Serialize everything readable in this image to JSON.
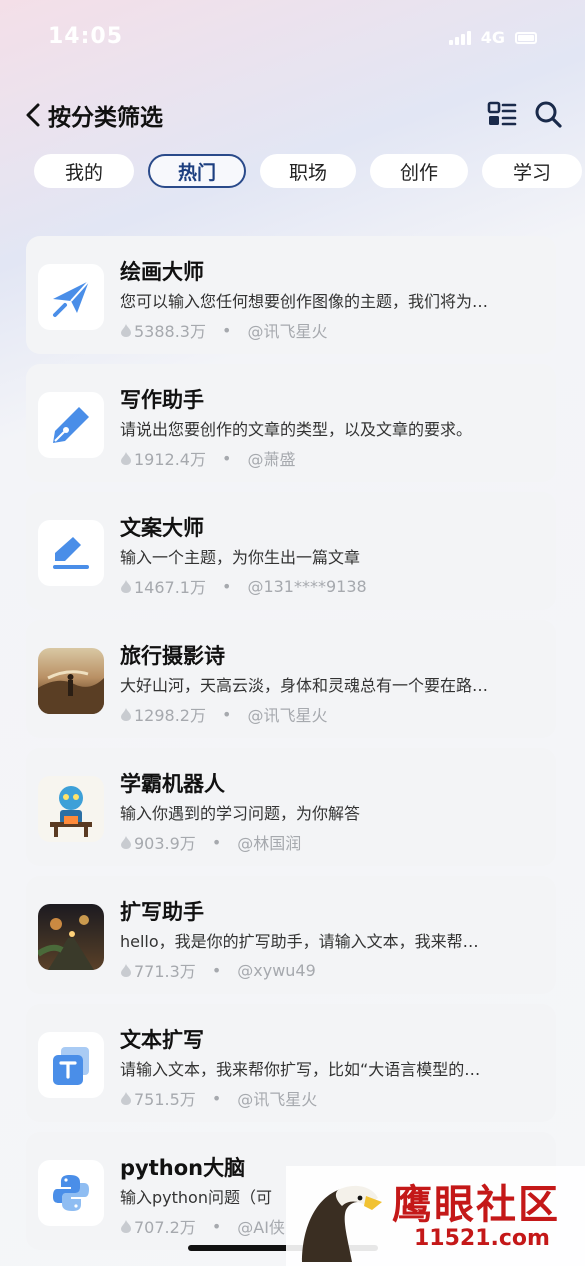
{
  "status": {
    "time": "14:05",
    "network": "4G"
  },
  "header": {
    "title": "按分类筛选"
  },
  "tabs": [
    {
      "label": "我的"
    },
    {
      "label": "热门"
    },
    {
      "label": "职场"
    },
    {
      "label": "创作"
    },
    {
      "label": "学习"
    }
  ],
  "active_tab": "热门",
  "items": [
    {
      "title": "绘画大师",
      "desc": "您可以输入您任何想要创作图像的主题，我们将为…",
      "count": "5388.3万",
      "author": "@讯飞星火",
      "icon": "paper-plane-brush-icon"
    },
    {
      "title": "写作助手",
      "desc": "请说出您要创作的文章的类型，以及文章的要求。",
      "count": "1912.4万",
      "author": "@萧盛",
      "icon": "pen-nib-icon"
    },
    {
      "title": "文案大师",
      "desc": "输入一个主题，为你生出一篇文章",
      "count": "1467.1万",
      "author": "@131****9138",
      "icon": "edit-icon"
    },
    {
      "title": "旅行摄影诗",
      "desc": "大好山河，天高云淡，身体和灵魂总有一个要在路…",
      "count": "1298.2万",
      "author": "@讯飞星火",
      "icon": "travel-photo-thumbnail"
    },
    {
      "title": "学霸机器人",
      "desc": "输入你遇到的学习问题，为你解答",
      "count": "903.9万",
      "author": "@林国润",
      "icon": "robot-thumbnail"
    },
    {
      "title": "扩写助手",
      "desc": "hello，我是你的扩写助手，请输入文本，我来帮…",
      "count": "771.3万",
      "author": "@xywu49",
      "icon": "night-street-thumbnail"
    },
    {
      "title": "文本扩写",
      "desc": "请输入文本，我来帮你扩写，比如“大语言模型的…",
      "count": "751.5万",
      "author": "@讯飞星火",
      "icon": "text-t-icon"
    },
    {
      "title": "python大脑",
      "desc": "输入python问题（可",
      "count": "707.2万",
      "author": "@AI侠",
      "icon": "python-icon"
    }
  ],
  "watermark": {
    "title": "鹰眼社区",
    "url": "11521.com"
  },
  "colors": {
    "accent": "#2a4a8a",
    "icon_blue": "#4a8ee8",
    "watermark_red": "#c41818"
  }
}
